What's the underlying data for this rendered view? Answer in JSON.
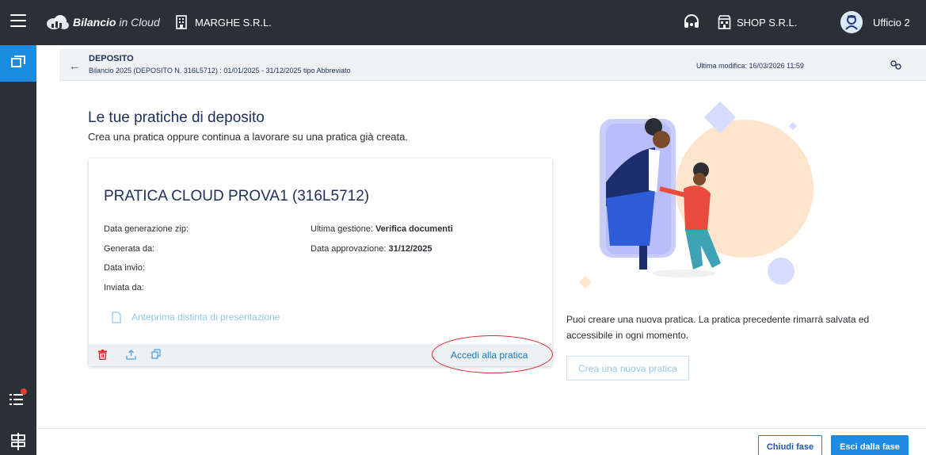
{
  "topbar": {
    "brand_bold": "Bilancio",
    "brand_light": " in Cloud",
    "company": "MARGHE S.R.L.",
    "shop": "SHOP S.R.L.",
    "user": "Ufficio 2"
  },
  "header": {
    "back_arrow": "←",
    "title": "DEPOSITO",
    "subtitle": "Bilancio 2025 (DEPOSITO N. 316L5712) : 01/01/2025 - 31/12/2025 tipo Abbreviato",
    "last_modified": "Ultima modifica: 16/03/2026 11:59"
  },
  "main": {
    "title": "Le tue pratiche di deposito",
    "subtitle": "Crea una pratica oppure continua a lavorare su una pratica già creata."
  },
  "card": {
    "title": "PRATICA CLOUD PROVA1 (316L5712)",
    "zip_date_label": "Data generazione zip:",
    "generated_by_label": "Generata da:",
    "send_date_label": "Data invio:",
    "sent_by_label": "Inviata da:",
    "last_action_label": "Ultima gestione:",
    "last_action_value": "Verifica documenti",
    "approval_label": "Data approvazione:",
    "approval_value": "31/12/2025",
    "preview_link": "Anteprima distinta di presentazione",
    "access_link": "Accedi alla pratica"
  },
  "right": {
    "info": "Puoi creare una nuova pratica. La pratica precedente rimarrà salvata ed accessibile in ogni momento.",
    "new_button": "Crea una nuova pratica"
  },
  "footer": {
    "close_phase": "Chiudi fase",
    "exit_phase": "Esci dalla fase"
  },
  "colors": {
    "topbar": "#2b3036",
    "accent": "#1d8ae3",
    "title": "#1f2f57",
    "link_light": "#8fc9ec",
    "highlight_circle": "#d8262c"
  },
  "icons": [
    "menu-icon",
    "cloud-logo-icon",
    "building-icon",
    "headset-icon",
    "store-icon",
    "user-avatar-icon",
    "folder-icon",
    "task-list-icon",
    "notification-dot",
    "document-list-icon",
    "arrow-left-icon",
    "settings-icon",
    "document-icon",
    "trash-icon",
    "upload-icon",
    "copy-icon"
  ]
}
